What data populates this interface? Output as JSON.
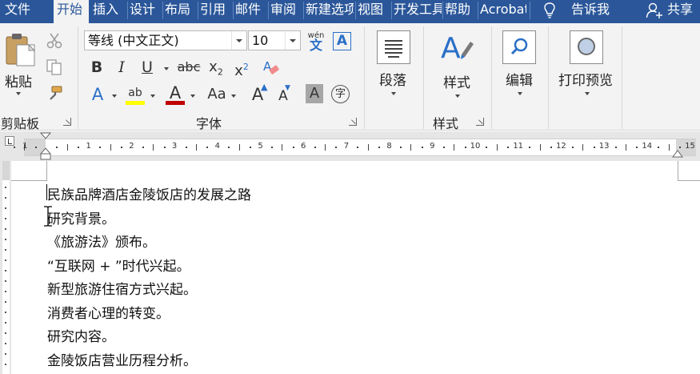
{
  "tabs": [
    "文件",
    "开始",
    "插入",
    "设计",
    "布局",
    "引用",
    "邮件",
    "审阅",
    "新建选项卡",
    "视图",
    "开发工具",
    "帮助",
    "Acrobat",
    "告诉我",
    "共享"
  ],
  "active_tab": "开始",
  "clipboard": {
    "paste_label": "粘贴",
    "group_label": "剪贴板"
  },
  "font": {
    "name": "等线 (中文正文)",
    "size": "10",
    "group_label": "字体",
    "wen_label": "wén",
    "wen_char": "文",
    "bold": "B",
    "italic": "I",
    "underline": "U",
    "strike": "abc",
    "subscript": "x",
    "sub_index": "2",
    "superscript": "x",
    "sup_index": "2",
    "text_effect": "A",
    "highlight": "ab",
    "font_color": "A",
    "case": "Aa",
    "grow": "A",
    "shrink": "A",
    "char_shading": "A",
    "enclosed": "字",
    "border_char": "A",
    "highlight_color": "#ffff00",
    "font_color_value": "#c00000"
  },
  "paragraph": {
    "label": "段落"
  },
  "styles": {
    "label": "样式",
    "group_label": "样式"
  },
  "editing": {
    "label": "编辑"
  },
  "print_preview": {
    "label": "打印预览"
  },
  "ruler": {
    "numbers": [
      "1",
      "1",
      "2",
      "3",
      "4",
      "5",
      "6",
      "7",
      "8",
      "9",
      "10",
      "11",
      "12",
      "13",
      "14",
      "15"
    ]
  },
  "document": {
    "lines": [
      "民族品牌酒店金陵饭店的发展之路",
      "研究背景。",
      "《旅游法》颁布。",
      "“互联网 + ”时代兴起。",
      "新型旅游住宿方式兴起。",
      "消费者心理的转变。",
      "研究内容。",
      "金陵饭店营业历程分析。"
    ]
  },
  "colors": {
    "accent": "#2b579a",
    "ribbon_bg": "#f3f3f3",
    "icon_blue": "#2b6fc7"
  }
}
